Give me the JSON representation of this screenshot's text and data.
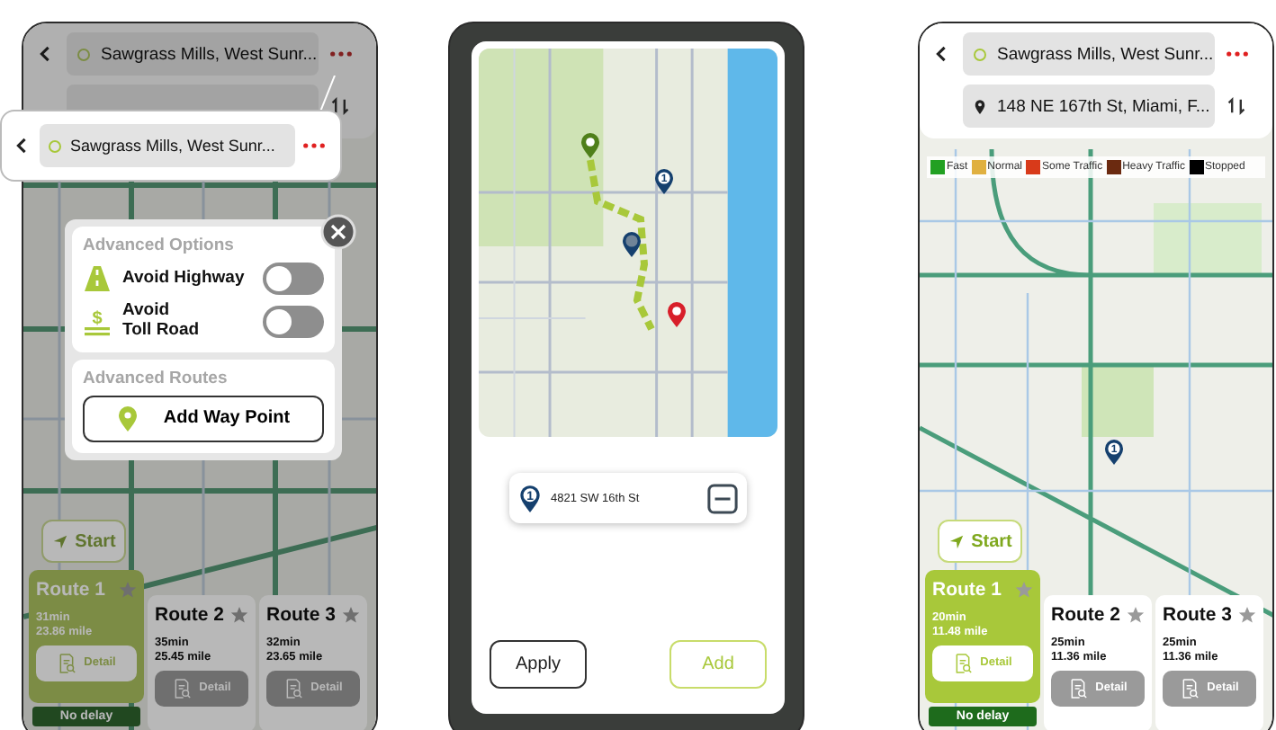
{
  "left_screen": {
    "origin": "Sawgrass Mills, West Sunr...",
    "callout_origin": "Sawgrass Mills, West Sunr...",
    "options_title": "Advanced Options",
    "toggles": [
      {
        "kind": "highway",
        "label": "Avoid Highway",
        "on": false
      },
      {
        "kind": "toll",
        "symbol": "$",
        "label": "Avoid\nToll Road",
        "on": false
      }
    ],
    "routes_title": "Advanced Routes",
    "waypoint_button": "Add Way Point",
    "start": "Start",
    "routes": [
      {
        "name": "Route 1",
        "selected": true,
        "time": "31min",
        "distance": "23.86 mile",
        "detail": "Detail",
        "status": "No delay"
      },
      {
        "name": "Route 2",
        "selected": false,
        "time": "35min",
        "distance": "25.45 mile",
        "detail": "Detail"
      },
      {
        "name": "Route 3",
        "selected": false,
        "time": "32min",
        "distance": "23.65 mile",
        "detail": "Detail"
      }
    ]
  },
  "middle_screen": {
    "map_pin": "1",
    "waypoints": [
      {
        "number": "1",
        "address": "4821 SW 16th St"
      }
    ],
    "apply": "Apply",
    "add": "Add"
  },
  "right_screen": {
    "origin": "Sawgrass Mills, West Sunr...",
    "destination": "148 NE 167th St, Miami, F...",
    "legend": [
      {
        "label": "Fast",
        "color": "#22a022"
      },
      {
        "label": "Normal",
        "color": "#e0b040"
      },
      {
        "label": "Some Traffic",
        "color": "#d83a1a"
      },
      {
        "label": "Heavy Traffic",
        "color": "#6b2a10"
      },
      {
        "label": "Stopped",
        "color": "#000000"
      }
    ],
    "map_pin": "1",
    "start": "Start",
    "routes": [
      {
        "name": "Route 1",
        "selected": true,
        "time": "20min",
        "distance": "11.48 mile",
        "detail": "Detail",
        "status": "No delay"
      },
      {
        "name": "Route 2",
        "selected": false,
        "time": "25min",
        "distance": "11.36 mile",
        "detail": "Detail"
      },
      {
        "name": "Route 3",
        "selected": false,
        "time": "25min",
        "distance": "11.36 mile",
        "detail": "Detail"
      }
    ]
  }
}
